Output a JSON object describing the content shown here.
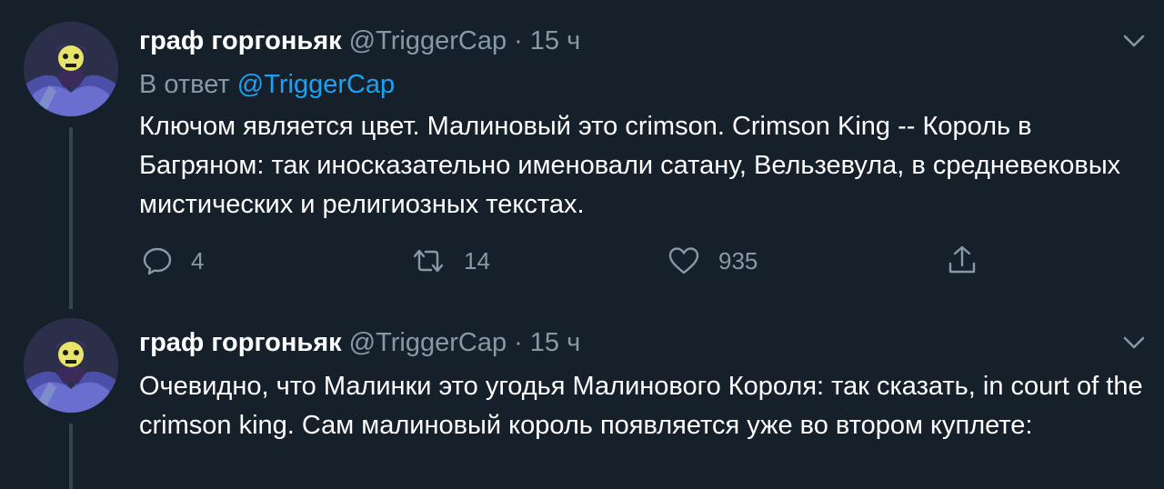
{
  "tweets": [
    {
      "author_name": "граф горгоньяк",
      "handle": "@TriggerCap",
      "separator": "·",
      "time": "15 ч",
      "reply_prefix": "В ответ",
      "reply_mention": "@TriggerCap",
      "text": "Ключом является цвет. Малиновый это crimson. Crimson King -- Король в Багряном: так иносказательно именовали сатану, Вельзевула, в средневековых мистических и религиозных текстах.",
      "actions": {
        "replies": "4",
        "retweets": "14",
        "likes": "935"
      }
    },
    {
      "author_name": "граф горгоньяк",
      "handle": "@TriggerCap",
      "separator": "·",
      "time": "15 ч",
      "text": "Очевидно, что Малинки это угодья Малинового Короля: так сказать, in court of the crimson king. Сам малиновый король появляется уже во втором куплете:"
    }
  ],
  "icons": {
    "more": "chevron-down-icon",
    "reply": "reply-icon",
    "retweet": "retweet-icon",
    "like": "heart-icon",
    "share": "share-icon"
  },
  "colors": {
    "background": "#15202b",
    "text": "#ffffff",
    "secondary": "#8899a6",
    "link": "#1da1f2",
    "thread_line": "#38444d"
  }
}
